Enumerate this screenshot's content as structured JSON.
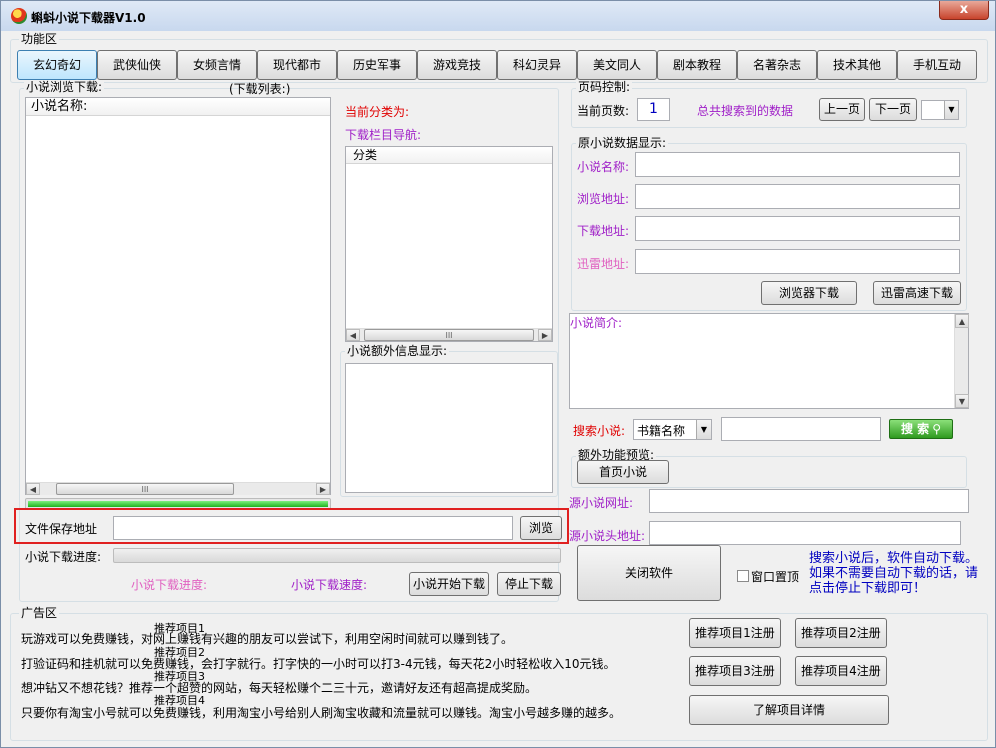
{
  "window": {
    "title": "蝌蚪小说下载器V1.0",
    "close_label": "x"
  },
  "function_area": {
    "label": "功能区",
    "tabs": [
      "玄幻奇幻",
      "武侠仙侠",
      "女频言情",
      "现代都市",
      "历史军事",
      "游戏竞技",
      "科幻灵异",
      "美文同人",
      "剧本教程",
      "名著杂志",
      "技术其他",
      "手机互动"
    ]
  },
  "browse": {
    "label": "小说浏览下载:",
    "download_list_label": "(下载列表:)",
    "list_header": "小说名称:",
    "scroll_thumb": "III"
  },
  "category": {
    "current_label": "当前分类为:",
    "nav_label": "下载栏目导航:",
    "list_header": "分类",
    "extra_info_label": "小说额外信息显示:"
  },
  "paging": {
    "label": "页码控制:",
    "current_page_label": "当前页数:",
    "current_page_value": "1",
    "total_label": "总共搜索到的数据",
    "prev_label": "上一页",
    "next_label": "下一页"
  },
  "original": {
    "label": "原小说数据显示:",
    "name_label": "小说名称:",
    "browse_url_label": "浏览地址:",
    "download_url_label": "下载地址:",
    "thunder_url_label": "迅雷地址:",
    "browser_download_label": "浏览器下载",
    "thunder_download_label": "迅雷高速下载",
    "intro_label": "小说简介:"
  },
  "search": {
    "label": "搜索小说:",
    "mode_value": "书籍名称",
    "button_label": "搜 索"
  },
  "extra": {
    "label": "额外功能预览:",
    "home_button": "首页小说",
    "source_url_label": "源小说网址:",
    "source_header_label": "源小说头地址:"
  },
  "save": {
    "path_label": "文件保存地址",
    "path_value": "",
    "browse_button": "浏览",
    "progress_label": "小说下载进度:",
    "progress_text_label": "小说下载进度:",
    "speed_label": "小说下载速度:",
    "start_button": "小说开始下载",
    "stop_button": "停止下载",
    "list_progress": 1.0
  },
  "controls": {
    "close_software": "关闭软件",
    "pin_window": "窗口置顶",
    "hint": "搜索小说后，软件自动下载。如果不需要自动下载的话，请点击停止下载即可！"
  },
  "ads": {
    "label": "广告区",
    "lines": [
      "玩游戏可以免费赚钱，对网上赚钱有兴趣的朋友可以尝试下，利用空闲时间就可以赚到钱了。",
      "打验证码和挂机就可以免费赚钱，会打字就行。打字快的一小时可以打3-4元钱，每天花2小时轻松收入10元钱。",
      "想冲钻又不想花钱？推荐一个超赞的网站，每天轻松赚个二三十元，邀请好友还有超高提成奖励。",
      "只要你有淘宝小号就可以免费赚钱，利用淘宝小号给别人刷淘宝收藏和流量就可以赚钱。淘宝小号越多赚的越多。"
    ],
    "overlay_labels": [
      "推荐项目1",
      "推荐项目2",
      "推荐项目3",
      "推荐项目4"
    ],
    "buttons": [
      "推荐项目1注册",
      "推荐项目2注册",
      "推荐项目3注册",
      "推荐项目4注册"
    ],
    "details_button": "了解项目详情"
  },
  "colors": {
    "highlight_border": "#e02020",
    "progress_green": "#22c022",
    "search_green": "#3a9e2a"
  }
}
